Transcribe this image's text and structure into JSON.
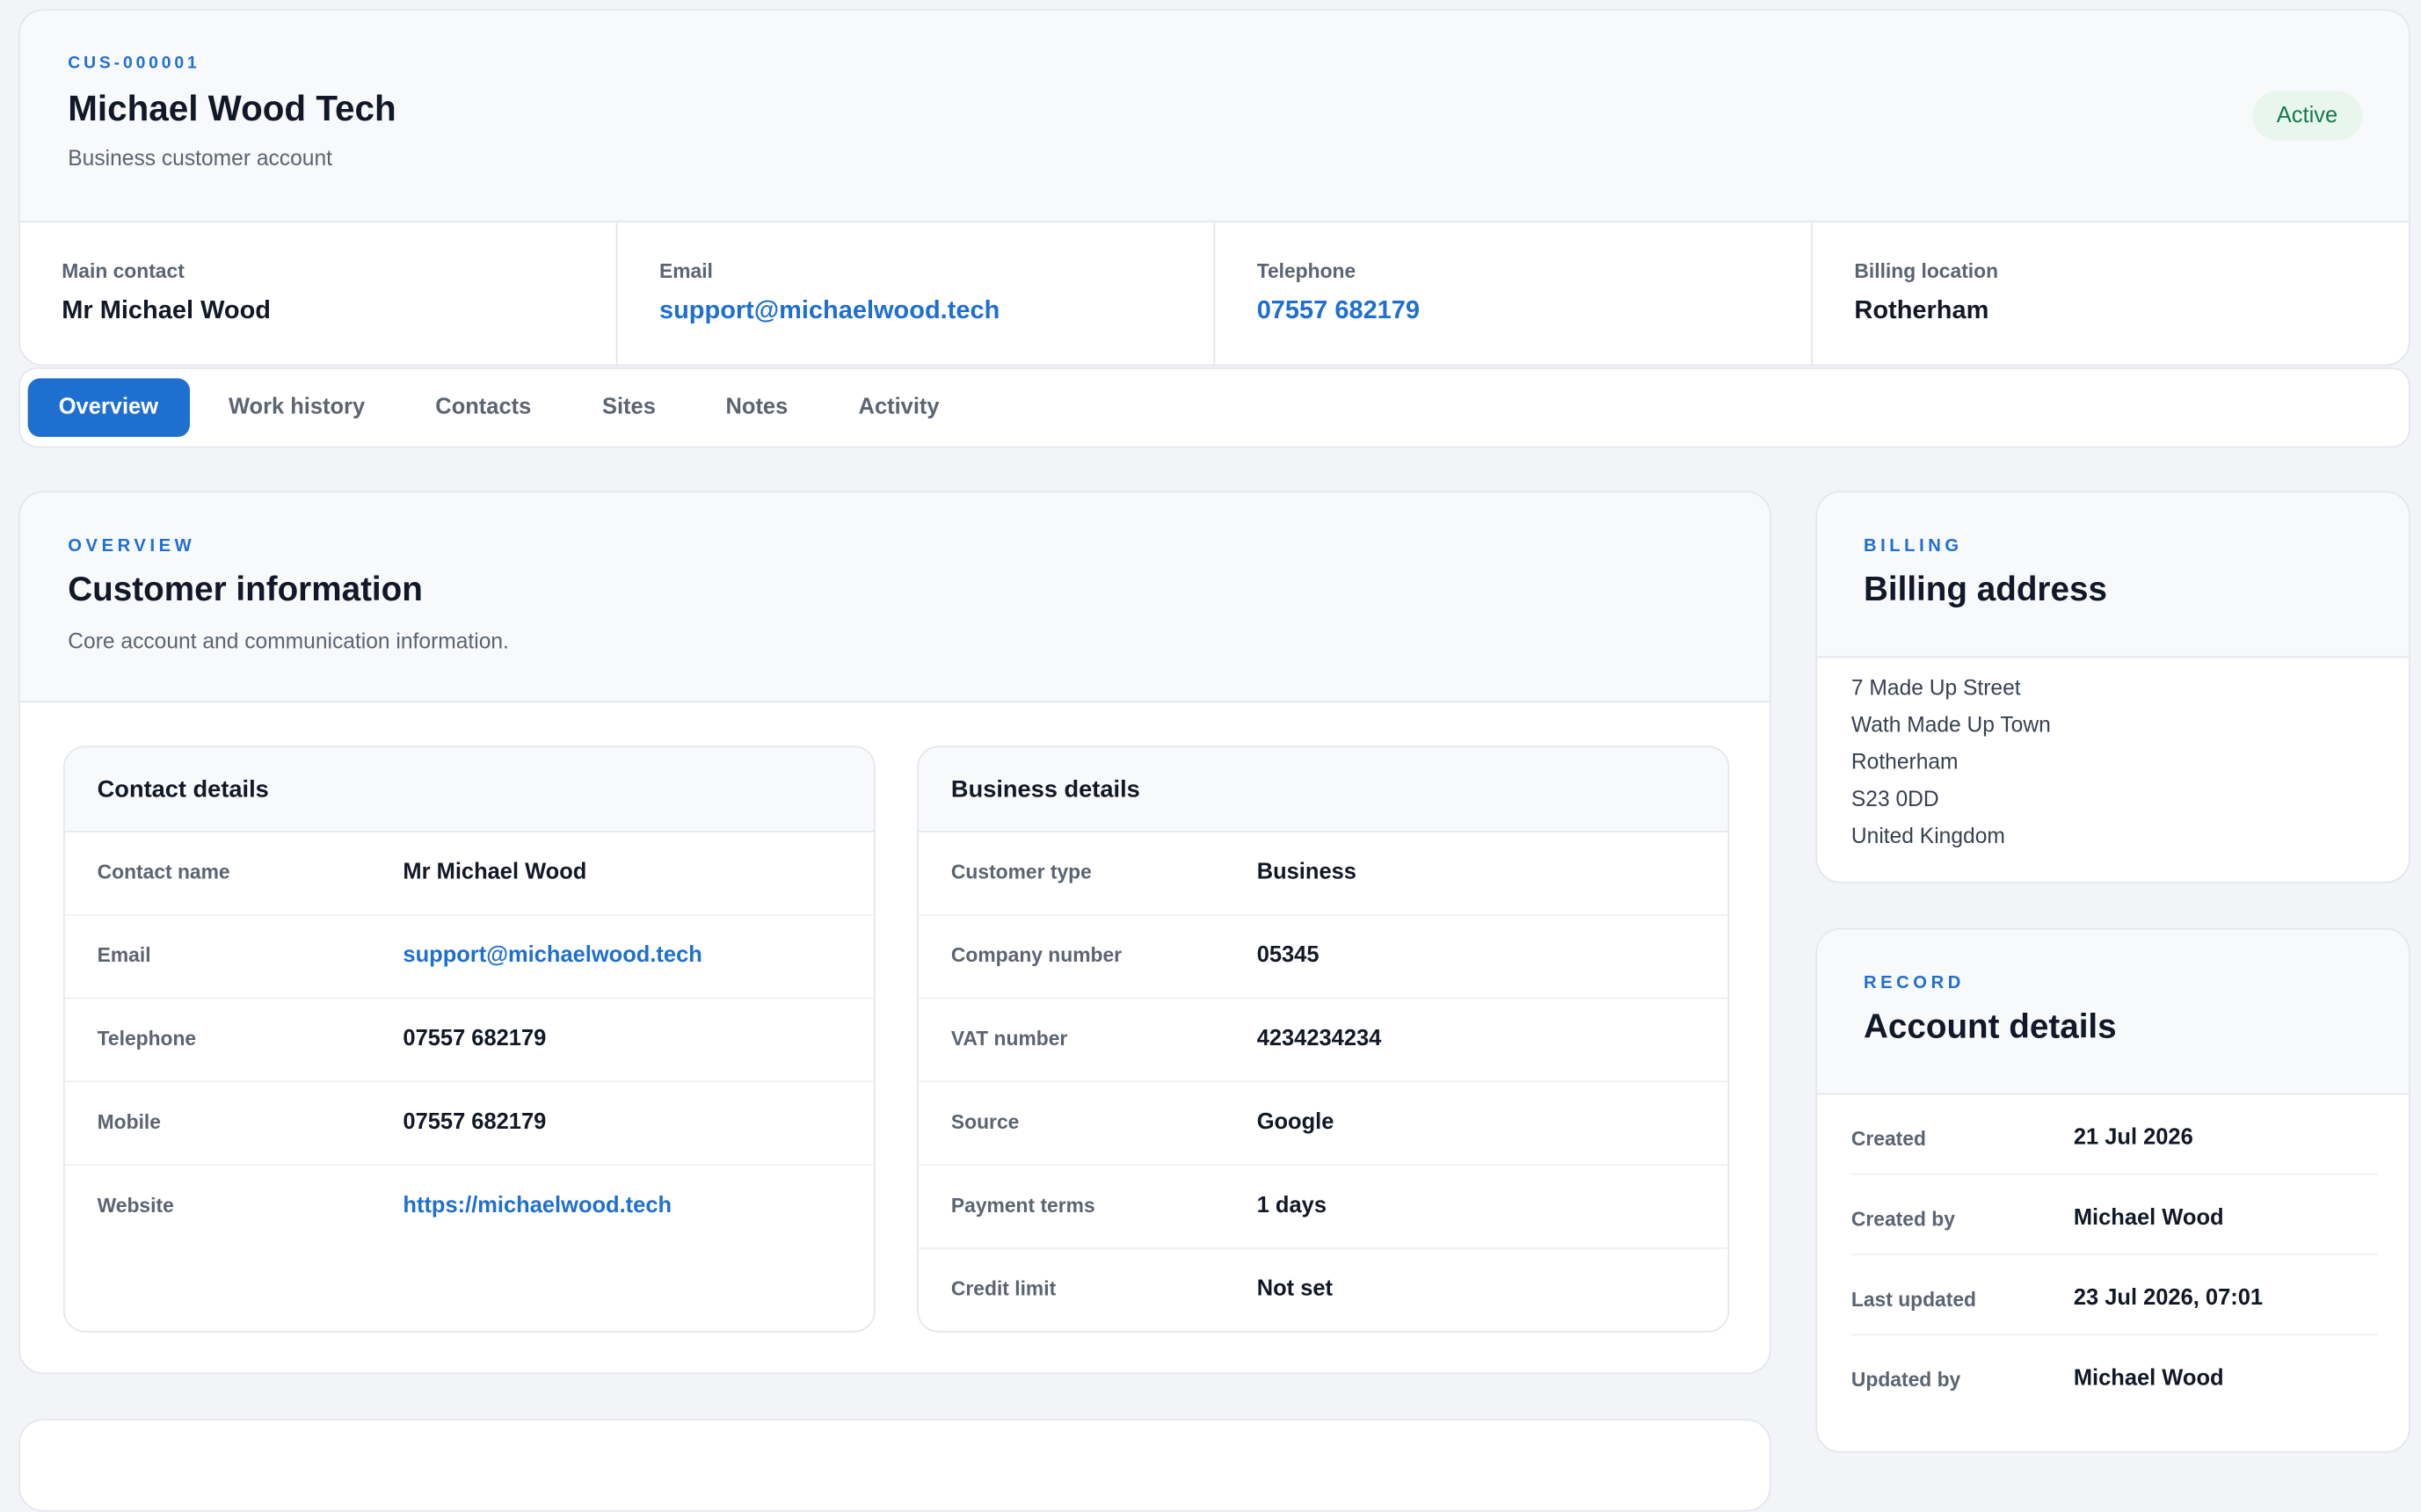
{
  "header": {
    "customer_id": "CUS-000001",
    "name": "Michael Wood Tech",
    "subtitle": "Business customer account",
    "status": "Active",
    "info": [
      {
        "label": "Main contact",
        "value": "Mr Michael Wood"
      },
      {
        "label": "Email",
        "value": "support@michaelwood.tech"
      },
      {
        "label": "Telephone",
        "value": "07557 682179"
      },
      {
        "label": "Billing location",
        "value": "Rotherham"
      }
    ]
  },
  "tabs": [
    {
      "label": "Overview"
    },
    {
      "label": "Work history"
    },
    {
      "label": "Contacts"
    },
    {
      "label": "Sites"
    },
    {
      "label": "Notes"
    },
    {
      "label": "Activity"
    }
  ],
  "overview": {
    "eyebrow": "OVERVIEW",
    "title": "Customer information",
    "subtitle": "Core account and communication information.",
    "contact": {
      "title": "Contact details",
      "rows": [
        {
          "label": "Contact name",
          "value": "Mr Michael Wood"
        },
        {
          "label": "Email",
          "value": "support@michaelwood.tech"
        },
        {
          "label": "Telephone",
          "value": "07557 682179"
        },
        {
          "label": "Mobile",
          "value": "07557 682179"
        },
        {
          "label": "Website",
          "value": "https://michaelwood.tech"
        }
      ]
    },
    "business": {
      "title": "Business details",
      "rows": [
        {
          "label": "Customer type",
          "value": "Business"
        },
        {
          "label": "Company number",
          "value": "05345"
        },
        {
          "label": "VAT number",
          "value": "4234234234"
        },
        {
          "label": "Source",
          "value": "Google"
        },
        {
          "label": "Payment terms",
          "value": "1 days"
        },
        {
          "label": "Credit limit",
          "value": "Not set"
        }
      ]
    }
  },
  "billing": {
    "eyebrow": "BILLING",
    "title": "Billing address",
    "lines": [
      "7 Made Up Street",
      "Wath Made Up Town",
      "Rotherham",
      "S23 0DD",
      "United Kingdom"
    ]
  },
  "record": {
    "eyebrow": "RECORD",
    "title": "Account details",
    "rows": [
      {
        "label": "Created",
        "value": "21 Jul 2026"
      },
      {
        "label": "Created by",
        "value": "Michael Wood"
      },
      {
        "label": "Last updated",
        "value": "23 Jul 2026, 07:01"
      },
      {
        "label": "Updated by",
        "value": "Michael Wood"
      }
    ]
  },
  "colors": {
    "accent": "#1f6fd1",
    "status_bg": "#e8f6ee",
    "status_text": "#16794a",
    "page_bg": "#f2f4f7"
  }
}
